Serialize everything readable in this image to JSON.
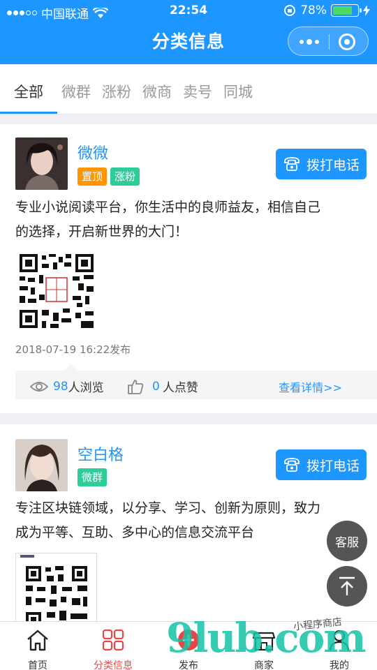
{
  "status_bar": {
    "carrier": "中国联通",
    "time": "22:54",
    "battery": "78%",
    "battery_level": 0.78
  },
  "header": {
    "title": "分类信息"
  },
  "tabs": [
    {
      "label": "全部",
      "active": true
    },
    {
      "label": "微群"
    },
    {
      "label": "涨粉"
    },
    {
      "label": "微商"
    },
    {
      "label": "卖号"
    },
    {
      "label": "同城"
    }
  ],
  "posts": [
    {
      "name": "微微",
      "tags": [
        "置顶",
        "涨粉"
      ],
      "call_label": "拨打电话",
      "text_line1": "专业小说阅读平台，你生活中的良师益友，相信自己",
      "text_line2": "的选择，开启新世界的大门！",
      "date": "2018-07-19 16:22发布",
      "views": "98",
      "views_label": "人浏览",
      "likes": "0",
      "likes_label": "人点赞",
      "detail_label": "查看详情>>"
    },
    {
      "name": "空白格",
      "tags": [
        "微群"
      ],
      "call_label": "拨打电话",
      "text_line1": "专注区块链领域，以分享、学习、创新为原则，致力",
      "text_line2": "成为平等、互助、多中心的信息交流平台"
    }
  ],
  "floating": {
    "service_label": "客服"
  },
  "bottom_nav": [
    {
      "label": "首页",
      "icon": "home-icon"
    },
    {
      "label": "分类信息",
      "icon": "grid-icon",
      "active": true
    },
    {
      "label": "发布",
      "icon": "plus-icon"
    },
    {
      "label": "商家",
      "icon": "shop-icon"
    },
    {
      "label": "我的",
      "icon": "user-icon"
    }
  ],
  "watermark": {
    "text": "9lub.com",
    "script": "小程序商店"
  },
  "colors": {
    "primary": "#1e96ff",
    "tag_orange": "#ff9500",
    "tag_green": "#2ecc9a",
    "active_nav": "#e84545"
  }
}
